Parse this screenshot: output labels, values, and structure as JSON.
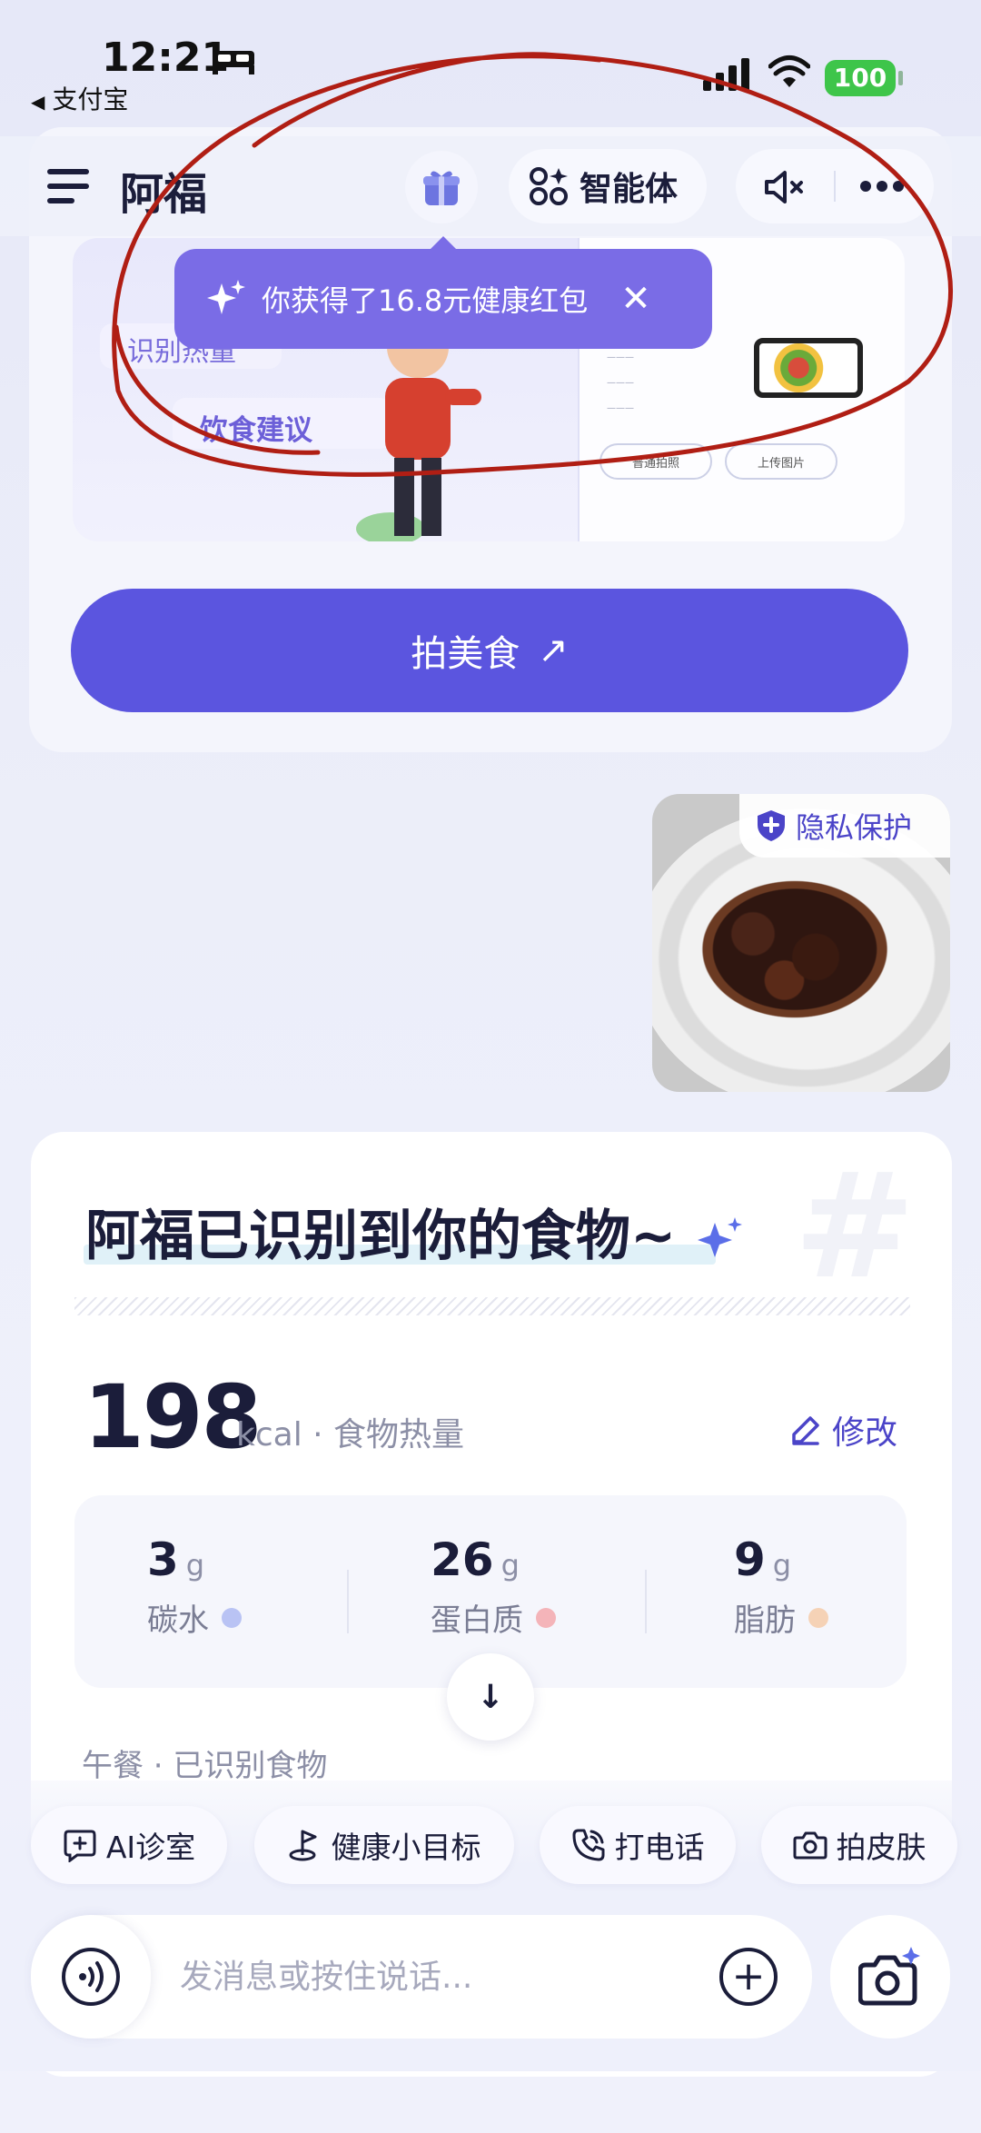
{
  "status_bar": {
    "time": "12:21",
    "back_app": "支付宝",
    "battery": "100"
  },
  "header": {
    "title": "阿福",
    "agent_label": "智能体"
  },
  "tooltip": {
    "text": "你获得了16.8元健康红包"
  },
  "banner": {
    "chip_calorie": "识别热量",
    "chip_advice": "饮食建议",
    "mock_btn_normal": "普通拍照",
    "mock_btn_upload": "上传图片"
  },
  "shoot_button": "拍美食",
  "food_photo": {
    "privacy_label": "隐私保护"
  },
  "result": {
    "title": "阿福已识别到你的食物~",
    "kcal": "198",
    "kcal_label": "kcal · 食物热量",
    "edit_label": "修改",
    "macros": [
      {
        "value": "3",
        "unit": "g",
        "name": "碳水",
        "dot_color": "#b9c3f4"
      },
      {
        "value": "26",
        "unit": "g",
        "name": "蛋白质",
        "dot_color": "#f4b4b9"
      },
      {
        "value": "9",
        "unit": "g",
        "name": "脂肪",
        "dot_color": "#f5d2b6"
      }
    ],
    "meal_label": "午餐 · 已识别食物"
  },
  "quick_actions": [
    {
      "label": "AI诊室",
      "icon": "chat-plus-icon"
    },
    {
      "label": "健康小目标",
      "icon": "target-flag-icon"
    },
    {
      "label": "打电话",
      "icon": "phone-icon"
    },
    {
      "label": "拍皮肤",
      "icon": "camera-icon"
    }
  ],
  "input": {
    "placeholder": "发消息或按住说话..."
  },
  "colors": {
    "accent": "#5b55df",
    "tooltip": "#7a6ce6",
    "annotation": "#b01e14"
  }
}
